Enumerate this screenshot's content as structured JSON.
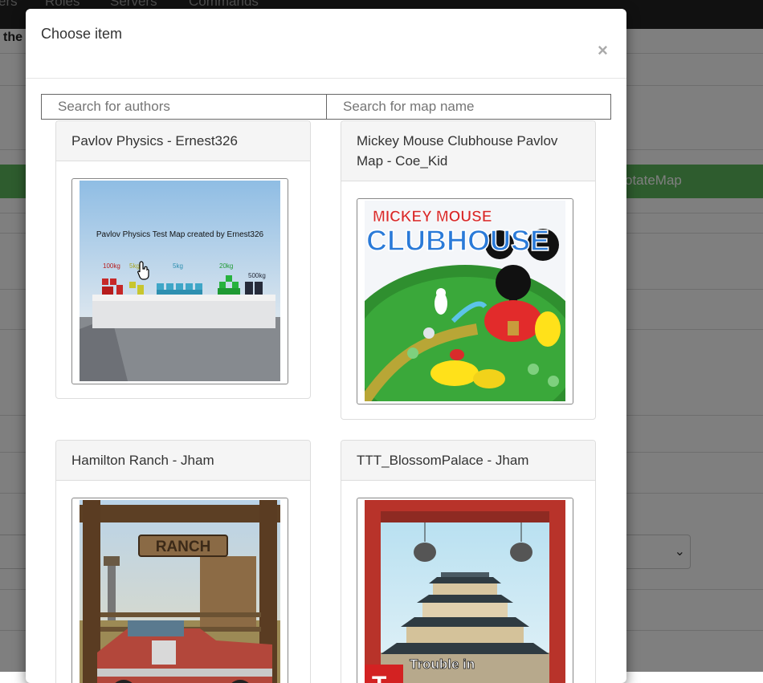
{
  "background": {
    "nav": [
      "ers",
      "Roles",
      "Servers",
      "Commands"
    ],
    "page_text": "the",
    "green_button": "otateMap",
    "select_chevron": "⌄"
  },
  "modal": {
    "title": "Choose item",
    "close": "×",
    "search_authors_placeholder": "Search for authors",
    "search_map_placeholder": "Search for map name",
    "items": [
      {
        "title": "Pavlov Physics - Ernest326",
        "image": {
          "caption": "Pavlov Physics Test Map created by Ernest326",
          "labels": [
            "100kg",
            "5kg",
            "5kg",
            "20kg",
            "500kg"
          ]
        }
      },
      {
        "title": "Mickey Mouse Clubhouse Pavlov Map - Coe_Kid",
        "image": {
          "logo_line1": "MICKEY MOUSE",
          "logo_line2": "CLUBHOUSE"
        }
      },
      {
        "title": "Hamilton Ranch - Jham",
        "image": {
          "sign": "RANCH"
        }
      },
      {
        "title": "TTT_BlossomPalace - Jham",
        "image": {
          "badge": "Trouble in"
        }
      }
    ]
  }
}
